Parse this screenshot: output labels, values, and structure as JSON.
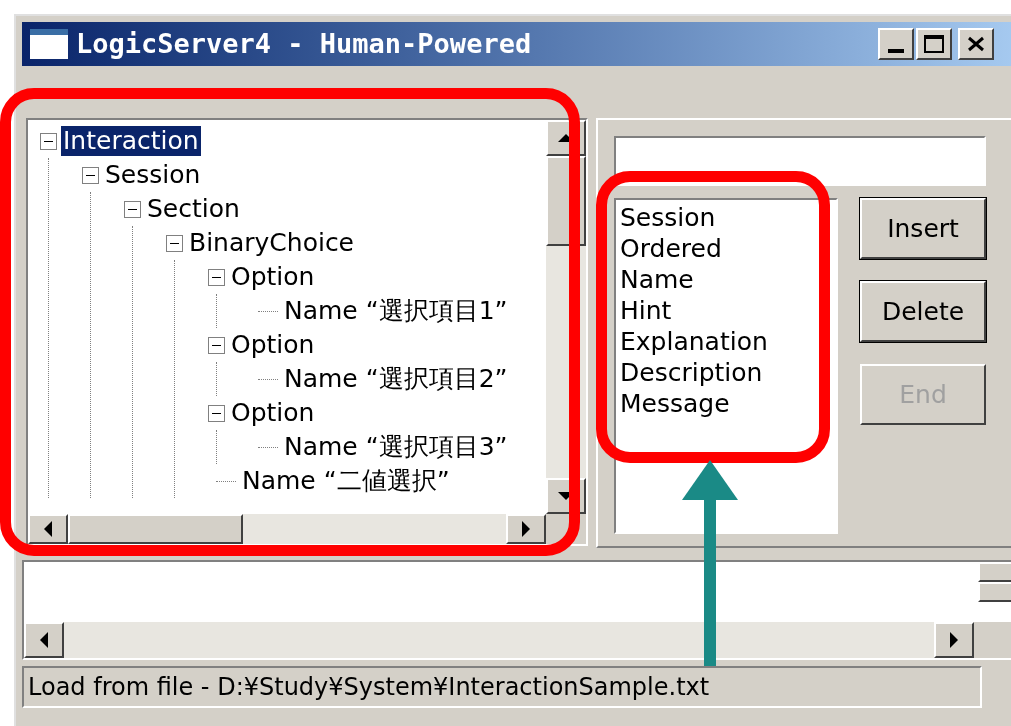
{
  "window": {
    "title": "LogicServer4 - Human-Powered"
  },
  "tree": [
    {
      "label": "Interaction",
      "selected": true,
      "expanded": true,
      "children": [
        {
          "label": "Session",
          "selected": false,
          "expanded": true,
          "children": [
            {
              "label": "Section",
              "selected": false,
              "expanded": true,
              "children": [
                {
                  "label": "BinaryChoice",
                  "selected": false,
                  "expanded": true,
                  "children": [
                    {
                      "label": "Option",
                      "selected": false,
                      "expanded": true,
                      "children": [
                        {
                          "label": "Name “選択項目1”",
                          "selected": false
                        }
                      ]
                    },
                    {
                      "label": "Option",
                      "selected": false,
                      "expanded": true,
                      "children": [
                        {
                          "label": "Name “選択項目2”",
                          "selected": false
                        }
                      ]
                    },
                    {
                      "label": "Option",
                      "selected": false,
                      "expanded": true,
                      "children": [
                        {
                          "label": "Name “選択項目3”",
                          "selected": false
                        }
                      ]
                    },
                    {
                      "label": "Name “二値選択”",
                      "selected": false
                    }
                  ]
                }
              ]
            }
          ]
        }
      ]
    }
  ],
  "list": [
    "Session",
    "Ordered",
    "Name",
    "Hint",
    "Explanation",
    "Description",
    "Message"
  ],
  "buttons": [
    {
      "label": "Insert",
      "disabled": false
    },
    {
      "label": "Delete",
      "disabled": false
    },
    {
      "label": "End",
      "disabled": true
    }
  ],
  "status_bar": "Load from file - D:¥Study¥System¥InteractionSample.txt"
}
